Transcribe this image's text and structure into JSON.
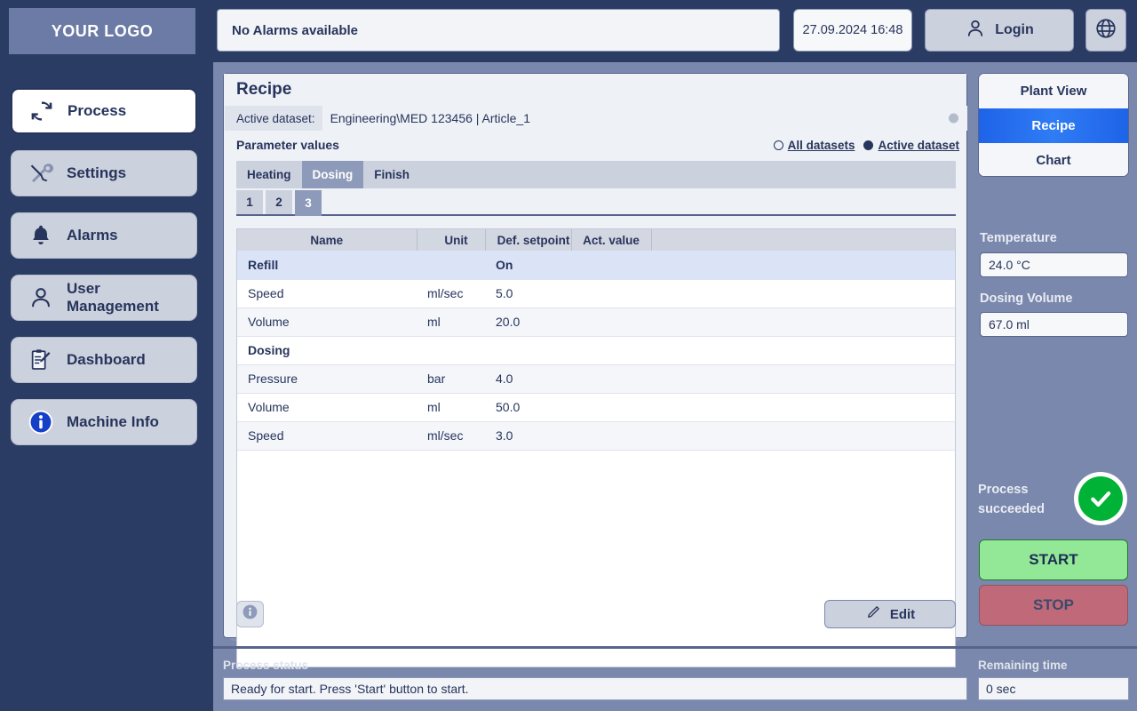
{
  "sidebar": {
    "logo": "YOUR LOGO",
    "items": [
      {
        "label": "Process",
        "icon": "refresh-cycle-icon",
        "active": true
      },
      {
        "label": "Settings",
        "icon": "tools-icon",
        "active": false
      },
      {
        "label": "Alarms",
        "icon": "bell-icon",
        "active": false
      },
      {
        "label": "User Management",
        "icon": "user-icon",
        "active": false
      },
      {
        "label": "Dashboard",
        "icon": "clipboard-pen-icon",
        "active": false
      },
      {
        "label": "Machine Info",
        "icon": "info-circle-icon",
        "active": false
      }
    ]
  },
  "header": {
    "alarm_text": "No Alarms available",
    "datetime": "27.09.2024 16:48",
    "login_label": "Login",
    "login_icon": "user-icon",
    "language_icon": "globe-icon"
  },
  "recipe": {
    "title": "Recipe",
    "dataset_label": "Active dataset:",
    "dataset_value": "Engineering\\MED 123456 | Article_1",
    "parameter_values_label": "Parameter values",
    "filter": {
      "all_label": "All datasets",
      "active_label": "Active dataset",
      "selected": "Active dataset"
    },
    "tabs": [
      {
        "label": "Heating",
        "active": false
      },
      {
        "label": "Dosing",
        "active": true
      },
      {
        "label": "Finish",
        "active": false
      }
    ],
    "subtabs": [
      {
        "label": "1",
        "active": false
      },
      {
        "label": "2",
        "active": false
      },
      {
        "label": "3",
        "active": true
      }
    ],
    "table": {
      "columns": [
        "Name",
        "Unit",
        "Def. setpoint",
        "Act. value",
        ""
      ],
      "rows": [
        {
          "name": "Refill",
          "unit": "",
          "setpoint": "On",
          "actual": "",
          "group": true,
          "style": "hl"
        },
        {
          "name": "Speed",
          "unit": "ml/sec",
          "setpoint": "5.0",
          "actual": "",
          "group": false,
          "style": "white"
        },
        {
          "name": "Volume",
          "unit": "ml",
          "setpoint": "20.0",
          "actual": "",
          "group": false,
          "style": "alt"
        },
        {
          "name": "Dosing",
          "unit": "",
          "setpoint": "",
          "actual": "",
          "group": true,
          "style": "white"
        },
        {
          "name": "Pressure",
          "unit": "bar",
          "setpoint": "4.0",
          "actual": "",
          "group": false,
          "style": "alt"
        },
        {
          "name": "Volume",
          "unit": "ml",
          "setpoint": "50.0",
          "actual": "",
          "group": false,
          "style": "white"
        },
        {
          "name": "Speed",
          "unit": "ml/sec",
          "setpoint": "3.0",
          "actual": "",
          "group": false,
          "style": "alt"
        }
      ]
    },
    "info_icon": "info-circle-icon",
    "edit_label": "Edit",
    "edit_icon": "pencil-icon"
  },
  "right_panel": {
    "views": [
      {
        "label": "Plant View",
        "active": false
      },
      {
        "label": "Recipe",
        "active": true
      },
      {
        "label": "Chart",
        "active": false
      }
    ],
    "temperature_label": "Temperature",
    "temperature_value": "24.0 °C",
    "dosing_volume_label": "Dosing Volume",
    "dosing_volume_value": "67.0 ml",
    "process_status_line1": "Process",
    "process_status_line2": "succeeded",
    "status_icon": "check-circle-icon",
    "start_label": "START",
    "stop_label": "STOP"
  },
  "footer": {
    "process_status_label": "Process status",
    "process_status_value": "Ready for start. Press 'Start' button to start.",
    "remaining_time_label": "Remaining time",
    "remaining_time_value": "0 sec"
  },
  "colors": {
    "sidebar_bg": "#2b3c64",
    "content_bg": "#7b88ad",
    "accent_blue": "#2f7cf5",
    "success_green": "#00b336",
    "start_green": "#93e898",
    "stop_red": "#c06a79",
    "text_dark": "#27355c"
  }
}
